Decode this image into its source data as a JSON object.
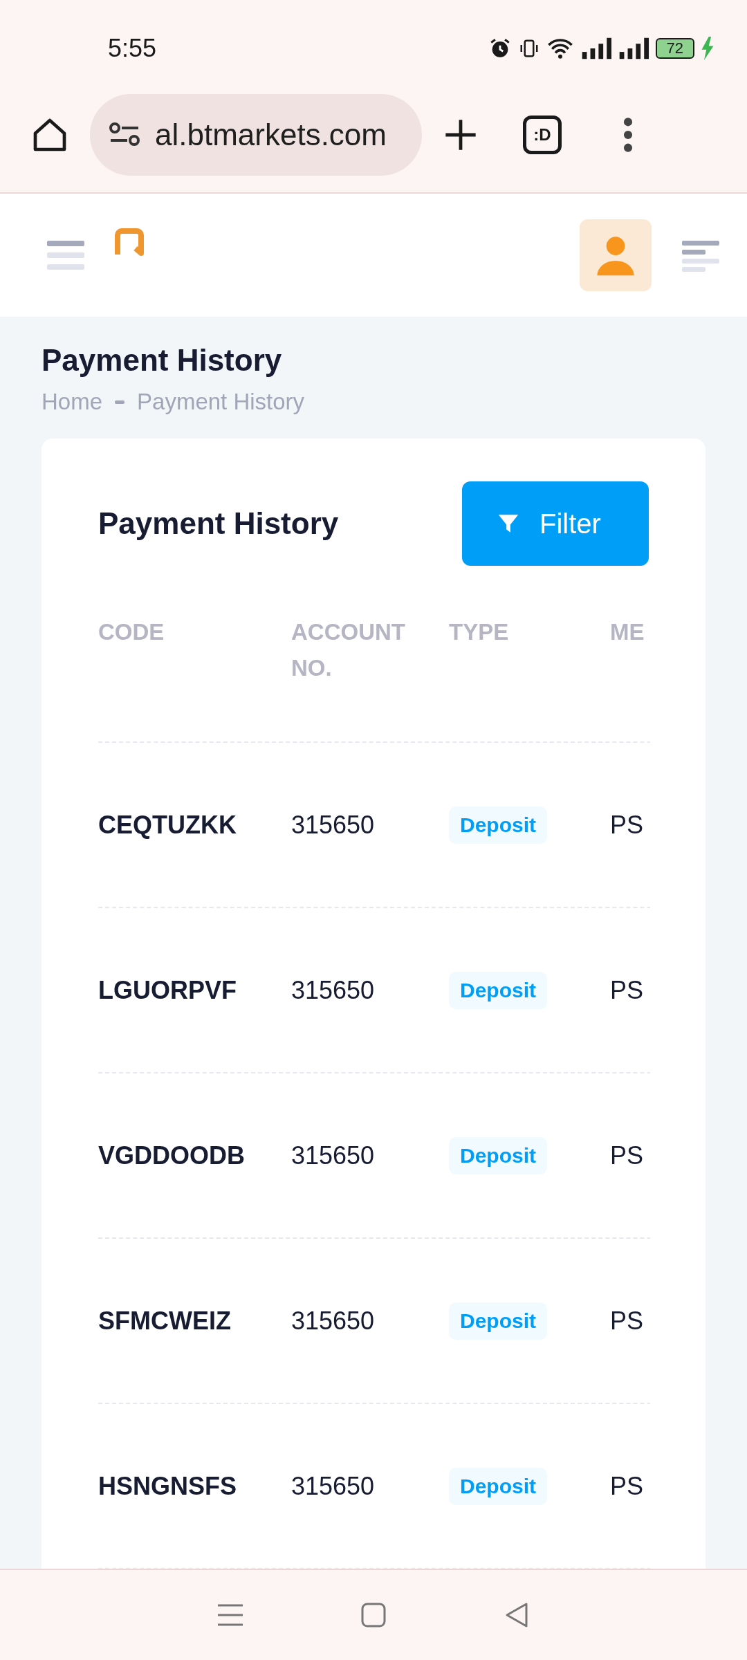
{
  "status_bar": {
    "time": "5:55",
    "battery": "72"
  },
  "browser": {
    "url": "al.btmarkets.com",
    "tab_switcher": ":D"
  },
  "page": {
    "title": "Payment History",
    "breadcrumb": [
      "Home",
      "Payment History"
    ]
  },
  "card": {
    "title": "Payment History",
    "filter_button": "Filter"
  },
  "table": {
    "columns": [
      "CODE",
      "ACCOUNT NO.",
      "TYPE",
      "ME"
    ],
    "rows": [
      {
        "code": "CEQTUZKK",
        "account": "315650",
        "type": "Deposit",
        "method": "PS"
      },
      {
        "code": "LGUORPVF",
        "account": "315650",
        "type": "Deposit",
        "method": "PS"
      },
      {
        "code": "VGDDOODB",
        "account": "315650",
        "type": "Deposit",
        "method": "PS"
      },
      {
        "code": "SFMCWEIZ",
        "account": "315650",
        "type": "Deposit",
        "method": "PS"
      },
      {
        "code": "HSNGNSFS",
        "account": "315650",
        "type": "Deposit",
        "method": "PS"
      }
    ]
  }
}
